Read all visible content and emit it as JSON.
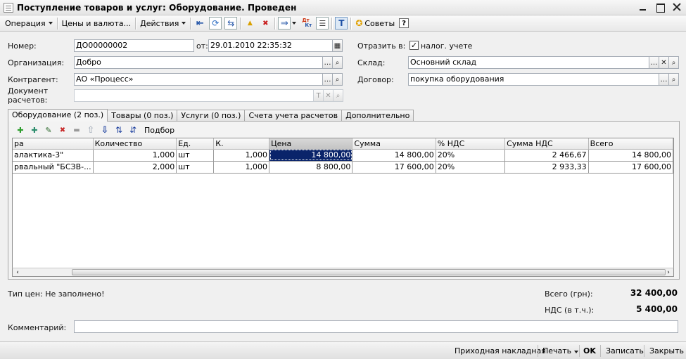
{
  "window": {
    "title": "Поступление товаров и услуг: Оборудование. Проведен"
  },
  "toolbar": {
    "operation": "Операция",
    "prices_currency": "Цены и валюта...",
    "actions": "Действия",
    "dtkt_top": "Дт",
    "dtkt_bottom": "Кт",
    "tips": "Советы",
    "help": "?"
  },
  "form": {
    "number_label": "Номер:",
    "number_value": "ДО00000002",
    "date_label": "от:",
    "date_value": "29.01.2010 22:35:32",
    "reflect_label": "Отразить в:",
    "tax_label": "налог. учете",
    "tax_checked": true,
    "org_label": "Организация:",
    "org_value": "Добро",
    "warehouse_label": "Склад:",
    "warehouse_value": "Основний склад",
    "contractor_label": "Контрагент:",
    "contractor_value": "АО «Процесс»",
    "contract_label": "Договор:",
    "contract_value": "покупка оборудования",
    "settlement_doc_label_1": "Документ",
    "settlement_doc_label_2": "расчетов:",
    "settlement_doc_value": ""
  },
  "tabs": [
    {
      "label": "Оборудование (2 поз.)",
      "active": true
    },
    {
      "label": "Товары (0 поз.)",
      "active": false
    },
    {
      "label": "Услуги (0 поз.)",
      "active": false
    },
    {
      "label": "Счета учета расчетов",
      "active": false
    },
    {
      "label": "Дополнительно",
      "active": false
    }
  ],
  "table_toolbar": {
    "pick": "Подбор"
  },
  "grid": {
    "columns": [
      "ра",
      "Количество",
      "Ед.",
      "К.",
      "Цена",
      "Сумма",
      "% НДС",
      "Сумма НДС",
      "Всего"
    ],
    "rows": [
      [
        "алактика-3\"",
        "1,000",
        "шт",
        "1,000",
        "14 800,00",
        "14 800,00",
        "20%",
        "2 466,67",
        "14 800,00"
      ],
      [
        "рвальный \"БСЗВ-...",
        "2,000",
        "шт",
        "1,000",
        "8 800,00",
        "17 600,00",
        "20%",
        "2 933,33",
        "17 600,00"
      ]
    ]
  },
  "footer": {
    "price_type": "Тип цен: Не заполнено!",
    "total_label": "Всего (грн):",
    "total_value": "32 400,00",
    "vat_label": "НДС (в т.ч.):",
    "vat_value": "5 400,00",
    "comment_label": "Комментарий:",
    "comment_value": ""
  },
  "statusbar": {
    "receipt_invoice": "Приходная накладная",
    "print": "Печать",
    "ok": "OK",
    "save": "Записать",
    "close": "Закрыть"
  }
}
